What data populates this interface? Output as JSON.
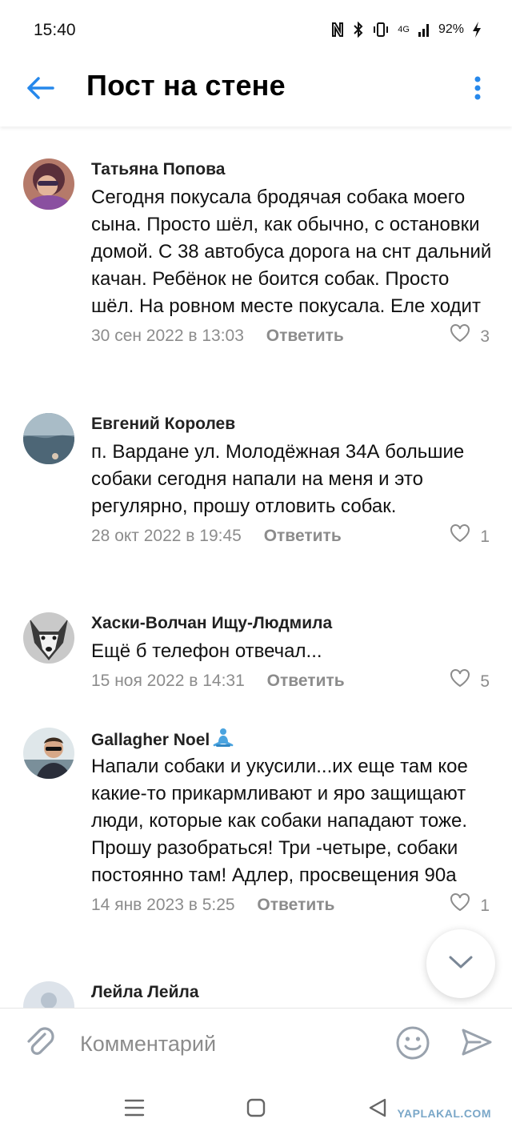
{
  "status_bar": {
    "time": "15:40",
    "network": "4G",
    "battery": "92%",
    "icons": [
      "nfc-icon",
      "bluetooth-icon",
      "vibrate-icon",
      "signal-icon",
      "battery-charging-icon"
    ]
  },
  "header": {
    "title": "Пост на стене",
    "back_icon": "arrow-left-icon",
    "menu_icon": "more-vertical-icon",
    "accent_color": "#2688eb"
  },
  "comments": [
    {
      "author": "Татьяна Попова",
      "text": "Сегодня покусала бродячая собака моего сына. Просто шёл, как обычно, с остановки домой. С 38 автобуса дорога на снт дальний качан. Ребёнок не боится собак. Просто шёл. На ровном месте покусала. Еле ходит",
      "date": "30 сен 2022 в 13:03",
      "reply_label": "Ответить",
      "likes": "3"
    },
    {
      "author": "Евгений Королев",
      "text": "п. Вардане ул. Молодёжная 34А большие собаки сегодня напали на меня и это регулярно, прошу отловить собак.",
      "date": "28 окт 2022 в 19:45",
      "reply_label": "Ответить",
      "likes": "1"
    },
    {
      "author": "Хаски-Волчан Ищу-Людмила",
      "text": "Ещё б телефон отвечал...",
      "date": "15 ноя 2022 в 14:31",
      "reply_label": "Ответить",
      "likes": "5"
    },
    {
      "author": "Gallagher Noel",
      "text": "Напали собаки и укусили...их еще там кое какие-то прикармливают и яро защищают люди, которые как собаки нападают тоже. Прошу разобраться! Три -четыре, собаки постоянно там! Адлер, просвещения 90а",
      "date": "14 янв 2023 в 5:25",
      "reply_label": "Ответить",
      "likes": "1"
    },
    {
      "author": "Лейла Лейла"
    }
  ],
  "composer": {
    "placeholder": "Комментарий",
    "attach_icon": "paperclip-icon",
    "emoji_icon": "smiley-icon",
    "send_icon": "send-icon"
  },
  "scroll_button_icon": "chevron-down-icon",
  "nav_bar": {
    "icons": [
      "menu-lines-icon",
      "home-square-icon",
      "back-triangle-icon"
    ],
    "watermark": "YAPLAKAL.COM"
  }
}
